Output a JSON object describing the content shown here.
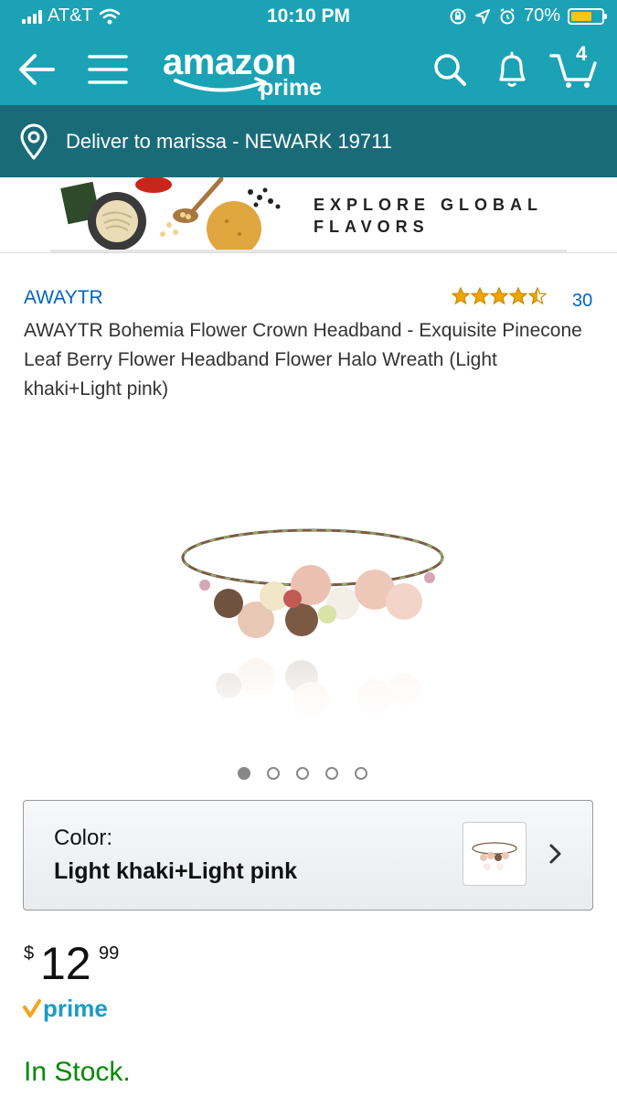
{
  "status_bar": {
    "carrier": "AT&T",
    "time": "10:10 PM",
    "battery": "70%",
    "battery_level": 0.7
  },
  "header": {
    "logo_word": "amazon",
    "logo_sub": "prime",
    "cart_count": "4",
    "icons": [
      "back-arrow-icon",
      "menu-icon",
      "search-icon",
      "bell-icon",
      "cart-icon"
    ]
  },
  "delivery": {
    "text": "Deliver to marissa - NEWARK 19711"
  },
  "ad": {
    "line1": "EXPLORE GLOBAL",
    "line2": "FLAVORS"
  },
  "product": {
    "brand": "AWAYTR",
    "rating_value": 4.5,
    "rating_count": "30",
    "title": "AWAYTR Bohemia Flower Crown Headband - Exquisite Pinecone Leaf Berry Flower Headband Flower Halo Wreath (Light khaki+Light pink)",
    "image_count": 5,
    "active_image_index": 0
  },
  "color_selector": {
    "label": "Color:",
    "value": "Light khaki+Light pink"
  },
  "price": {
    "currency": "$",
    "whole": "12",
    "fraction": "99"
  },
  "prime_badge": {
    "label": "prime"
  },
  "availability": {
    "text": "In Stock.",
    "color": "#008a00"
  },
  "colors": {
    "header_bg": "#1ba2b5",
    "delivery_bg": "#1a6b78",
    "link": "#0066c0",
    "star": "#f0a500"
  }
}
